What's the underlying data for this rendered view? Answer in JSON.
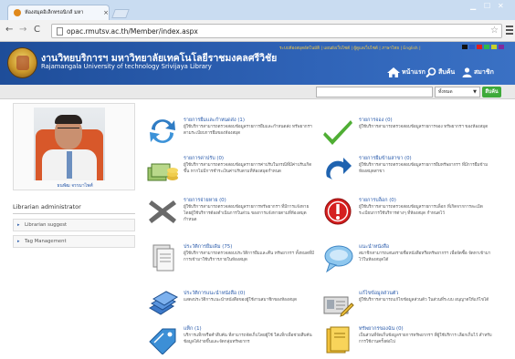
{
  "browser": {
    "tab_title": "ห้องสมุดอิเล็กทรอนิกส์ มหา",
    "tab_close": "×",
    "url": "opac.rmutsv.ac.th/Member/index.aspx",
    "window_controls": [
      "▁",
      "☐",
      "✕"
    ]
  },
  "header": {
    "top_links": "ระบบห้องสมุดอัตโนมัติ | แผนผังเว็บไซต์ | ผู้ดูแลเว็บไซต์ | ภาษาไทย | English |",
    "uni_thai": "งานวิทยบริการฯ มหาวิทยาลัยเทคโนโลยีราชมงคลศรีวิชัย",
    "uni_en": "Rajamangala University of technology Srivijaya Library",
    "nav": [
      {
        "label": "หน้าแรก",
        "icon": "home-icon"
      },
      {
        "label": "สืบค้น",
        "icon": "search-icon"
      },
      {
        "label": "สมาชิก",
        "icon": "member-icon"
      }
    ],
    "theme_colors": [
      "#111111",
      "#2a57c4",
      "#e01e1e",
      "#2fb84a",
      "#c7d02b",
      "#7f2a9e"
    ]
  },
  "search": {
    "placeholder": "",
    "select_value": "ทั้งหมด",
    "button": "สืบค้น"
  },
  "sidebar": {
    "profile_name": "ธนพัฒ จรรมาไพศ์",
    "heading": "Librarian administrator",
    "items": [
      {
        "label": "Librarian suggest"
      },
      {
        "label": "Tag Management"
      }
    ]
  },
  "menu": [
    {
      "title": "รายการยืมและกำหนดส่ง (1)",
      "desc": "ผู้ใช้บริการสามารถตรวจสอบข้อมูลรายการยืมและกำหนดส่ง ทรัพยากรฯ ตามระเบียบการยืมของห้องสมุด",
      "icon": "refresh-icon"
    },
    {
      "title": "รายการจอง (0)",
      "desc": "ผู้ใช้บริการสามารถตรวจสอบข้อมูลรายการจอง ทรัพยากรฯ ของห้องสมุด",
      "icon": "check-icon"
    },
    {
      "title": "รายการค่าปรับ (0)",
      "desc": "ผู้ใช้บริการสามารถตรวจสอบข้อมูลรายการค่าปรับในกรณีที่มีค่าปรับเกิดขึ้น หากไม่มีการชำระเงินค่าปรับตามที่ห้องสมุดกำหนด",
      "icon": "money-icon"
    },
    {
      "title": "รายการยืมข้ามสาขา (0)",
      "desc": "ผู้ใช้บริการสามารถตรวจสอบข้อมูลรายการยืมทรัพยากรฯ ที่มีการยืมข้ามห้องสมุดสาขา",
      "icon": "redo-arrow-icon"
    },
    {
      "title": "รายการจ่ายหาย (0)",
      "desc": "ผู้ใช้บริการสามารถตรวจสอบข้อมูลรายการทรัพยากรฯ ที่มีการแจ้งหาย โดยผู้ใช้บริการต้องดำเนินการในส่วน ของการแจ้งหายตามที่ห้องสมุดกำหนด",
      "icon": "x-mark-icon"
    },
    {
      "title": "รายการบล็อก (0)",
      "desc": "ผู้ใช้บริการสามารถตรวจสอบข้อมูลรายการบล็อก ที่เกิดจากการละเมิดระเบียบการใช้บริการต่างๆ ที่ห้องสมุด กำหนดไว้",
      "icon": "alert-icon"
    },
    {
      "title": "ประวัติการยืมเดิม (75)",
      "desc": "ผู้ใช้บริการสามารถตรวจสอบประวัติการยืมและคืน ทรัพยากรฯ ทั้งหมดที่มีการเข้ามาใช้บริการภายในห้องสมุด",
      "icon": "history-icon"
    },
    {
      "title": "แนะนำหนังสือ",
      "desc": "สมาชิกสามารถเสนอรายชื่อหนังสือหรือทรัพยากรฯ เพื่อจัดซื้อ จัดหาเข้ามาไว้ในห้องสมุดได้",
      "icon": "suggest-bubble-icon"
    },
    {
      "title": "ประวัติการแนะนำหนังสือ (0)",
      "desc": "แสดงประวัติการแนะนำหนังสือของผู้ใช้งานสมาชิกของห้องสมุด",
      "icon": "books-icon"
    },
    {
      "title": "แก้ไขข้อมูลส่วนตัว",
      "desc": "ผู้ใช้บริการสามารถแก้ไขข้อมูลส่วนตัว ในส่วนที่ระบบ อนุญาตให้แก้ไขได้",
      "icon": "edit-profile-icon"
    },
    {
      "title": "แท็ก (1)",
      "desc": "บริการแท็กหรือคำสืบค้น ที่สามารถจัดเก็บโดยผู้ใช้ ใส่แท็กเพื่อช่วยสืบค้นข้อมูลได้ง่ายขึ้นและจัดกลุ่มทรัพยากร",
      "icon": "tag-icon"
    },
    {
      "title": "ทรัพยากรของฉัน (0)",
      "desc": "เป็นส่วนที่จัดเก็บข้อมูลรายการทรัพยากรฯ ที่ผู้ใช้บริการ เลือกเก็บไว้ สำหรับการใช้งานครั้งต่อไป",
      "icon": "my-resources-icon"
    }
  ]
}
